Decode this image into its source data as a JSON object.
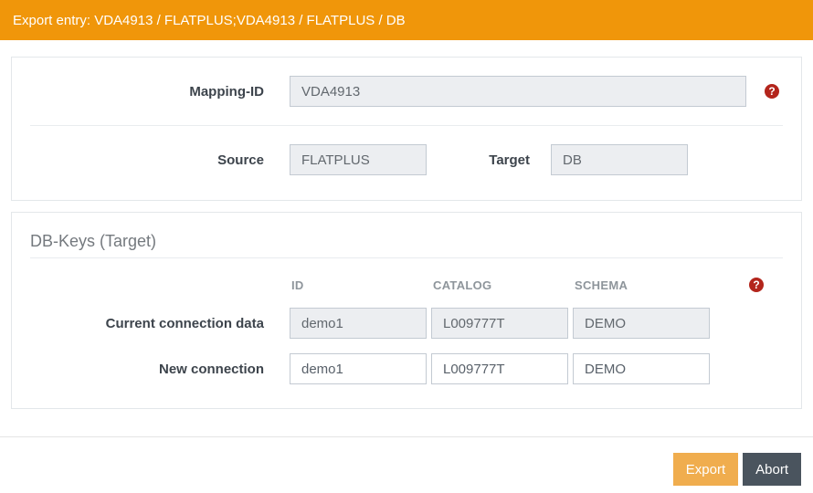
{
  "header": {
    "title": "Export entry: VDA4913 / FLATPLUS;VDA4913 / FLATPLUS / DB"
  },
  "mapping_panel": {
    "mapping_id": {
      "label": "Mapping-ID",
      "value": "VDA4913"
    },
    "source": {
      "label": "Source",
      "value": "FLATPLUS"
    },
    "target": {
      "label": "Target",
      "value": "DB"
    }
  },
  "db_keys_panel": {
    "title": "DB-Keys (Target)",
    "columns": [
      "ID",
      "CATALOG",
      "SCHEMA"
    ],
    "rows": [
      {
        "label": "Current connection data",
        "id": "demo1",
        "catalog": "L009777T",
        "schema": "DEMO",
        "disabled": true
      },
      {
        "label": "New connection",
        "id": "demo1",
        "catalog": "L009777T",
        "schema": "DEMO",
        "disabled": false
      }
    ]
  },
  "footer": {
    "export_label": "Export",
    "abort_label": "Abort"
  },
  "icons": {
    "help_glyph": "?"
  },
  "colors": {
    "header_bg": "#f0960a",
    "export_button_bg": "#f0ad4e",
    "abort_button_bg": "#4a545e",
    "help_icon_bg": "#b3251c",
    "disabled_input_bg": "#eceef1",
    "input_border": "#c3cad2",
    "panel_border": "#e3e7ea"
  }
}
